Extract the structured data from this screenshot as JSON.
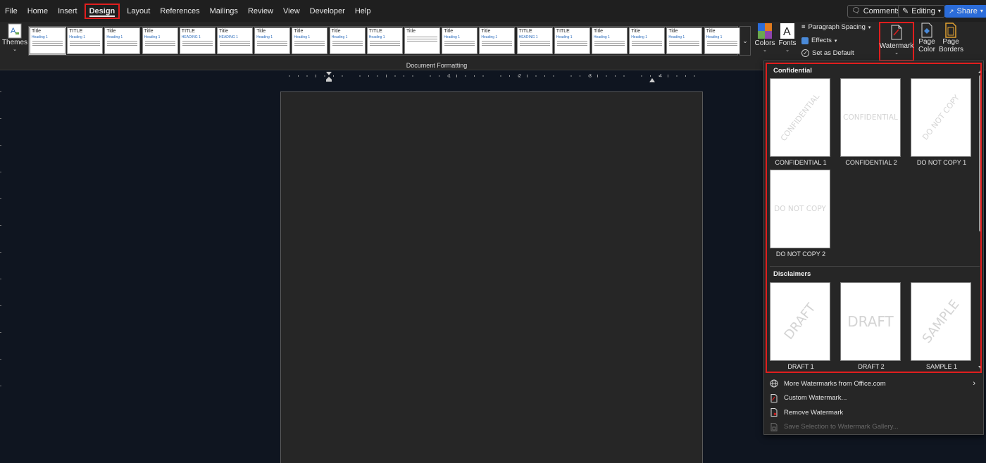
{
  "menu": {
    "tabs": [
      "File",
      "Home",
      "Insert",
      "Design",
      "Layout",
      "References",
      "Mailings",
      "Review",
      "View",
      "Developer",
      "Help"
    ],
    "active_tab": "Design",
    "comments_label": "Comments",
    "editing_label": "Editing",
    "share_label": "Share"
  },
  "ribbon": {
    "themes_label": "Themes",
    "colors_label": "Colors",
    "fonts_label": "Fonts",
    "paragraph_spacing_label": "Paragraph Spacing",
    "effects_label": "Effects",
    "set_default_label": "Set as Default",
    "watermark_label": "Watermark",
    "page_color_label": "Page Color",
    "page_borders_label": "Page Borders",
    "group_label": "Document Formatting",
    "style_thumbnails": [
      {
        "title": "Title",
        "heading": "Heading 1"
      },
      {
        "title": "TITLE",
        "heading": "Heading 1"
      },
      {
        "title": "Title",
        "heading": "Heading 1"
      },
      {
        "title": "Title",
        "heading": "Heading 1"
      },
      {
        "title": "TITLE",
        "heading": "HEADING 1"
      },
      {
        "title": "Title",
        "heading": "HEADING 1"
      },
      {
        "title": "Title",
        "heading": "Heading 1"
      },
      {
        "title": "Title",
        "heading": "Heading 1"
      },
      {
        "title": "Title",
        "heading": "Heading 1"
      },
      {
        "title": "TITLE",
        "heading": "Heading 1"
      },
      {
        "title": "Title",
        "heading": ""
      },
      {
        "title": "Title",
        "heading": "Heading 1"
      },
      {
        "title": "Title",
        "heading": "Heading 1"
      },
      {
        "title": "TITLE",
        "heading": "HEADING 1"
      },
      {
        "title": "TITLE",
        "heading": "Heading 1"
      },
      {
        "title": "Title",
        "heading": "Heading 1"
      },
      {
        "title": "Title",
        "heading": "Heading 1"
      },
      {
        "title": "Title",
        "heading": "Heading 1"
      },
      {
        "title": "Title",
        "heading": "Heading 1"
      }
    ]
  },
  "ruler": {
    "numbers": [
      "1",
      "2",
      "3",
      "4",
      "5",
      "6"
    ]
  },
  "watermark_menu": {
    "sections": [
      {
        "title": "Confidential",
        "items": [
          {
            "caption": "CONFIDENTIAL 1",
            "text": "CONFIDENTIAL",
            "style": "diagonal"
          },
          {
            "caption": "CONFIDENTIAL 2",
            "text": "CONFIDENTIAL",
            "style": "horizontal"
          },
          {
            "caption": "DO NOT COPY 1",
            "text": "DO NOT COPY",
            "style": "diagonal"
          },
          {
            "caption": "DO NOT COPY 2",
            "text": "DO NOT COPY",
            "style": "horizontal"
          }
        ]
      },
      {
        "title": "Disclaimers",
        "items": [
          {
            "caption": "DRAFT 1",
            "text": "DRAFT",
            "style": "diagonal"
          },
          {
            "caption": "DRAFT 2",
            "text": "DRAFT",
            "style": "horizontal"
          },
          {
            "caption": "SAMPLE 1",
            "text": "SAMPLE",
            "style": "diagonal"
          }
        ]
      }
    ],
    "actions": [
      {
        "label": "More Watermarks from Office.com",
        "icon": "globe-icon",
        "disabled": false,
        "submenu": true
      },
      {
        "label": "Custom Watermark...",
        "icon": "document-icon",
        "disabled": false,
        "submenu": false
      },
      {
        "label": "Remove Watermark",
        "icon": "remove-document-icon",
        "disabled": false,
        "submenu": false
      },
      {
        "label": "Save Selection to Watermark Gallery...",
        "icon": "save-document-icon",
        "disabled": true,
        "submenu": false
      }
    ]
  },
  "colors": {
    "highlight": "#e01e1e",
    "share": "#2b6cd9"
  }
}
